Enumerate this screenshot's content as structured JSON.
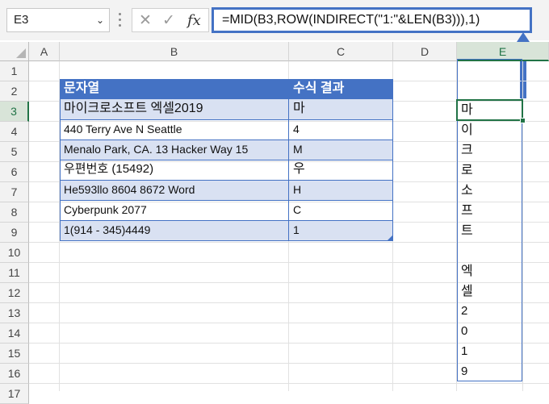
{
  "name_box": "E3",
  "formula_bar": {
    "formula": "=MID(B3,ROW(INDIRECT(\"1:\"&LEN(B3))),1)",
    "cancel_glyph": "✕",
    "enter_glyph": "✓",
    "fx_label": "fx"
  },
  "columns": [
    "A",
    "B",
    "C",
    "D",
    "E"
  ],
  "rows": [
    "1",
    "2",
    "3",
    "4",
    "5",
    "6",
    "7",
    "8",
    "9",
    "10",
    "11",
    "12",
    "13",
    "14",
    "15",
    "16",
    "17"
  ],
  "table": {
    "headers": [
      "문자열",
      "수식 결과"
    ],
    "rows": [
      {
        "text": "마이크로소프트 엑셀2019",
        "result": "마"
      },
      {
        "text": "440 Terry Ave N Seattle",
        "result": "4"
      },
      {
        "text": "Menalo Park, CA. 13 Hacker Way 15",
        "result": "M"
      },
      {
        "text": "우편번호 (15492)",
        "result": "우"
      },
      {
        "text": "He593llo 8604 8672 Word",
        "result": "H"
      },
      {
        "text": "Cyberpunk 2077",
        "result": "C"
      },
      {
        "text": "1(914 - 345)4449",
        "result": "1"
      }
    ]
  },
  "spill_results": [
    "마",
    "이",
    "크",
    "로",
    "소",
    "프",
    "트",
    "",
    "엑",
    "셀",
    "2",
    "0",
    "1",
    "9"
  ],
  "colors": {
    "accent": "#4472c4",
    "band": "#d9e1f2",
    "excel_green": "#217346"
  }
}
